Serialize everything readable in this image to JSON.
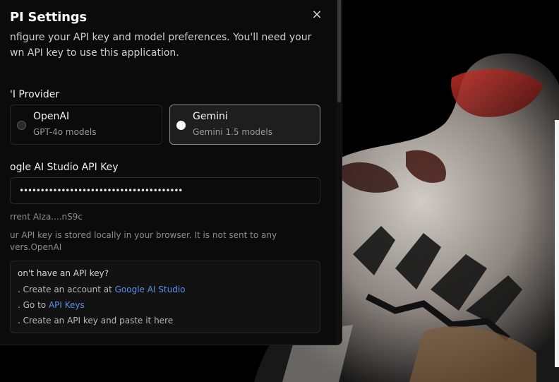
{
  "dialog": {
    "title": "PI Settings",
    "close_label": "×",
    "description": "nfigure your API key and model preferences. You'll need your\nwn API key to use this application."
  },
  "provider": {
    "section_label": "'I Provider",
    "options": [
      {
        "name": "OpenAI",
        "subtitle": "GPT-4o models",
        "selected": false
      },
      {
        "name": "Gemini",
        "subtitle": "Gemini 1.5 models",
        "selected": true
      }
    ]
  },
  "api_key": {
    "label": "ogle AI Studio API Key",
    "value": "•••••••••••••••••••••••••••••••••••••••",
    "current": "rrent AIza....nS9c",
    "note": "ur API key is stored locally in your browser. It is not sent to any\nvers.OpenAI"
  },
  "help": {
    "title": "on't have an API key?",
    "step1_prefix": ". Create an account at ",
    "step1_link": "Google AI Studio",
    "step2_prefix": ". Go to ",
    "step2_link": "API Keys",
    "step3": ". Create an API key and paste it here"
  },
  "colors": {
    "link": "#5b8fe8",
    "panel_bg": "#0b0b0b",
    "selected_card_bg": "#1e1e1e"
  }
}
